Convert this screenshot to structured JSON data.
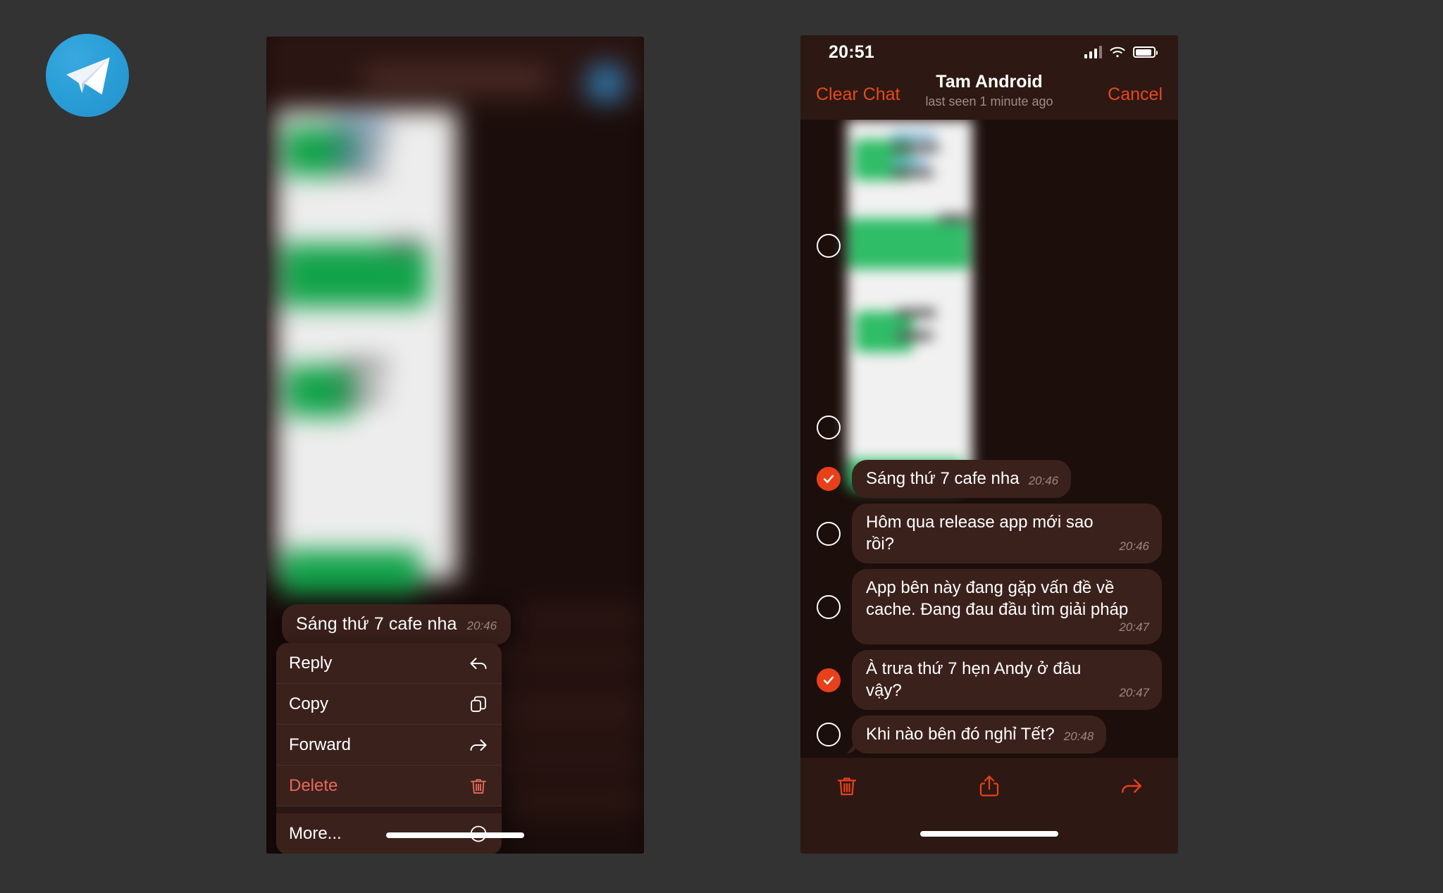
{
  "brand": {
    "logo_icon": "telegram-paper-plane-icon",
    "accent": "#2a9fd8"
  },
  "colors": {
    "accent_red": "#e8401a",
    "bubble_bg": "#3b211c",
    "chat_bg": "#1c0e0b",
    "bar_bg": "#2d1813",
    "page_bg": "#333333"
  },
  "left_phone": {
    "focused_message": {
      "text": "Sáng thứ 7 cafe nha",
      "time": "20:46"
    },
    "context_menu": [
      {
        "label": "Reply",
        "icon": "reply-arrow-icon",
        "danger": false
      },
      {
        "label": "Copy",
        "icon": "copy-documents-icon",
        "danger": false
      },
      {
        "label": "Forward",
        "icon": "forward-arrow-icon",
        "danger": false
      },
      {
        "label": "Delete",
        "icon": "trash-icon",
        "danger": true
      },
      {
        "label": "More...",
        "icon": "ellipsis-circle-icon",
        "danger": false
      }
    ]
  },
  "right_phone": {
    "status_bar": {
      "time": "20:51",
      "signal_icon": "cellular-bars-icon",
      "wifi_icon": "wifi-icon",
      "battery_icon": "battery-full-icon"
    },
    "nav_bar": {
      "left_action": "Clear Chat",
      "title": "Tam Android",
      "subtitle": "last seen 1 minute ago",
      "right_action": "Cancel"
    },
    "attachment": {
      "type": "image",
      "description": "screenshot",
      "selected": false
    },
    "messages": [
      {
        "text": "Sáng thứ 7 cafe nha",
        "time": "20:46",
        "selected": true,
        "tail": false
      },
      {
        "text": "Hôm qua release app mới sao rồi?",
        "time": "20:46",
        "selected": false,
        "tail": false
      },
      {
        "text": "App bên này đang gặp vấn đề về cache. Đang đau đầu tìm giải pháp",
        "time": "20:47",
        "selected": false,
        "tail": false
      },
      {
        "text": "À trưa thứ 7 hẹn Andy ở đâu vậy?",
        "time": "20:47",
        "selected": true,
        "tail": false
      },
      {
        "text": "Khi nào bên đó nghỉ Tết?",
        "time": "20:48",
        "selected": false,
        "tail": true
      }
    ],
    "toolbar": [
      {
        "icon": "trash-icon",
        "name": "delete-selected-button"
      },
      {
        "icon": "share-up-icon",
        "name": "share-selected-button"
      },
      {
        "icon": "forward-arrow-icon",
        "name": "forward-selected-button"
      }
    ]
  }
}
